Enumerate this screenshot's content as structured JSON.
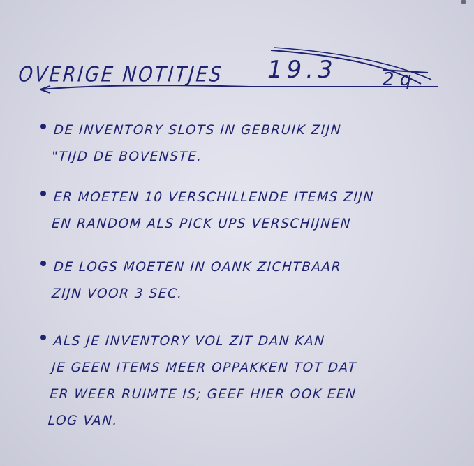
{
  "page": {
    "title": "Overige notitjes",
    "title_number": "19.3",
    "title_number_overwrite": "2 q",
    "notes": [
      "de inventory slots in gebruik zijn\n\"tijd de bovenste.",
      "er moeten 10 verschillende items zijn\nen random als pick ups verschijnen",
      "de logs moeten in oank zichtbaar\nzijn voor 3 sec.",
      "als je inventory vol zit dan kan\nje geen items meer oppakken tot dat\ner weer ruimte is; geef hier ook een\nlog van."
    ]
  },
  "colors": {
    "paper": "#d9dae6",
    "ink": "#1e2270"
  }
}
